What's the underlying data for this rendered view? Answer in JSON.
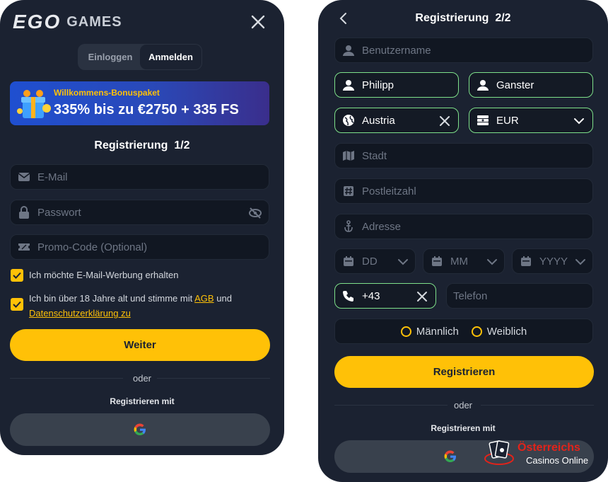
{
  "brand": {
    "logo_text": "EGO",
    "logo_suffix": "GAMES"
  },
  "tabs": {
    "login": "Einloggen",
    "register": "Anmelden"
  },
  "promo": {
    "title": "Willkommens-Bonuspaket",
    "offer": "335% bis zu €2750 + 335 FS"
  },
  "step1": {
    "title": "Registrierung  1/2",
    "email_placeholder": "E-Mail",
    "password_placeholder": "Passwort",
    "promo_placeholder": "Promo-Code (Optional)",
    "consent_marketing": "Ich möchte E-Mail-Werbung erhalten",
    "consent_age_prefix": "Ich bin über 18 Jahre alt und stimme mit",
    "consent_agb": "AGB",
    "consent_und": "und",
    "consent_privacy": "Datenschutzerklärung zu",
    "next_button": "Weiter",
    "or": "oder",
    "register_with": "Registrieren mit"
  },
  "step2": {
    "title": "Registrierung  2/2",
    "username_placeholder": "Benutzername",
    "first_name": "Philipp",
    "last_name": "Ganster",
    "country": "Austria",
    "currency": "EUR",
    "city_placeholder": "Stadt",
    "zip_placeholder": "Postleitzahl",
    "address_placeholder": "Adresse",
    "day_placeholder": "DD",
    "month_placeholder": "MM",
    "year_placeholder": "YYYY",
    "phone_prefix": "+43",
    "phone_placeholder": "Telefon",
    "gender_male": "Männlich",
    "gender_female": "Weiblich",
    "register_button": "Registrieren",
    "or": "oder",
    "register_with": "Registrieren mit"
  },
  "watermark": {
    "line1": "Österreichs",
    "line2": "Casinos Online"
  },
  "colors": {
    "panel": "#1b2231",
    "accent": "#ffc107",
    "selected_border": "#7ee08a"
  }
}
